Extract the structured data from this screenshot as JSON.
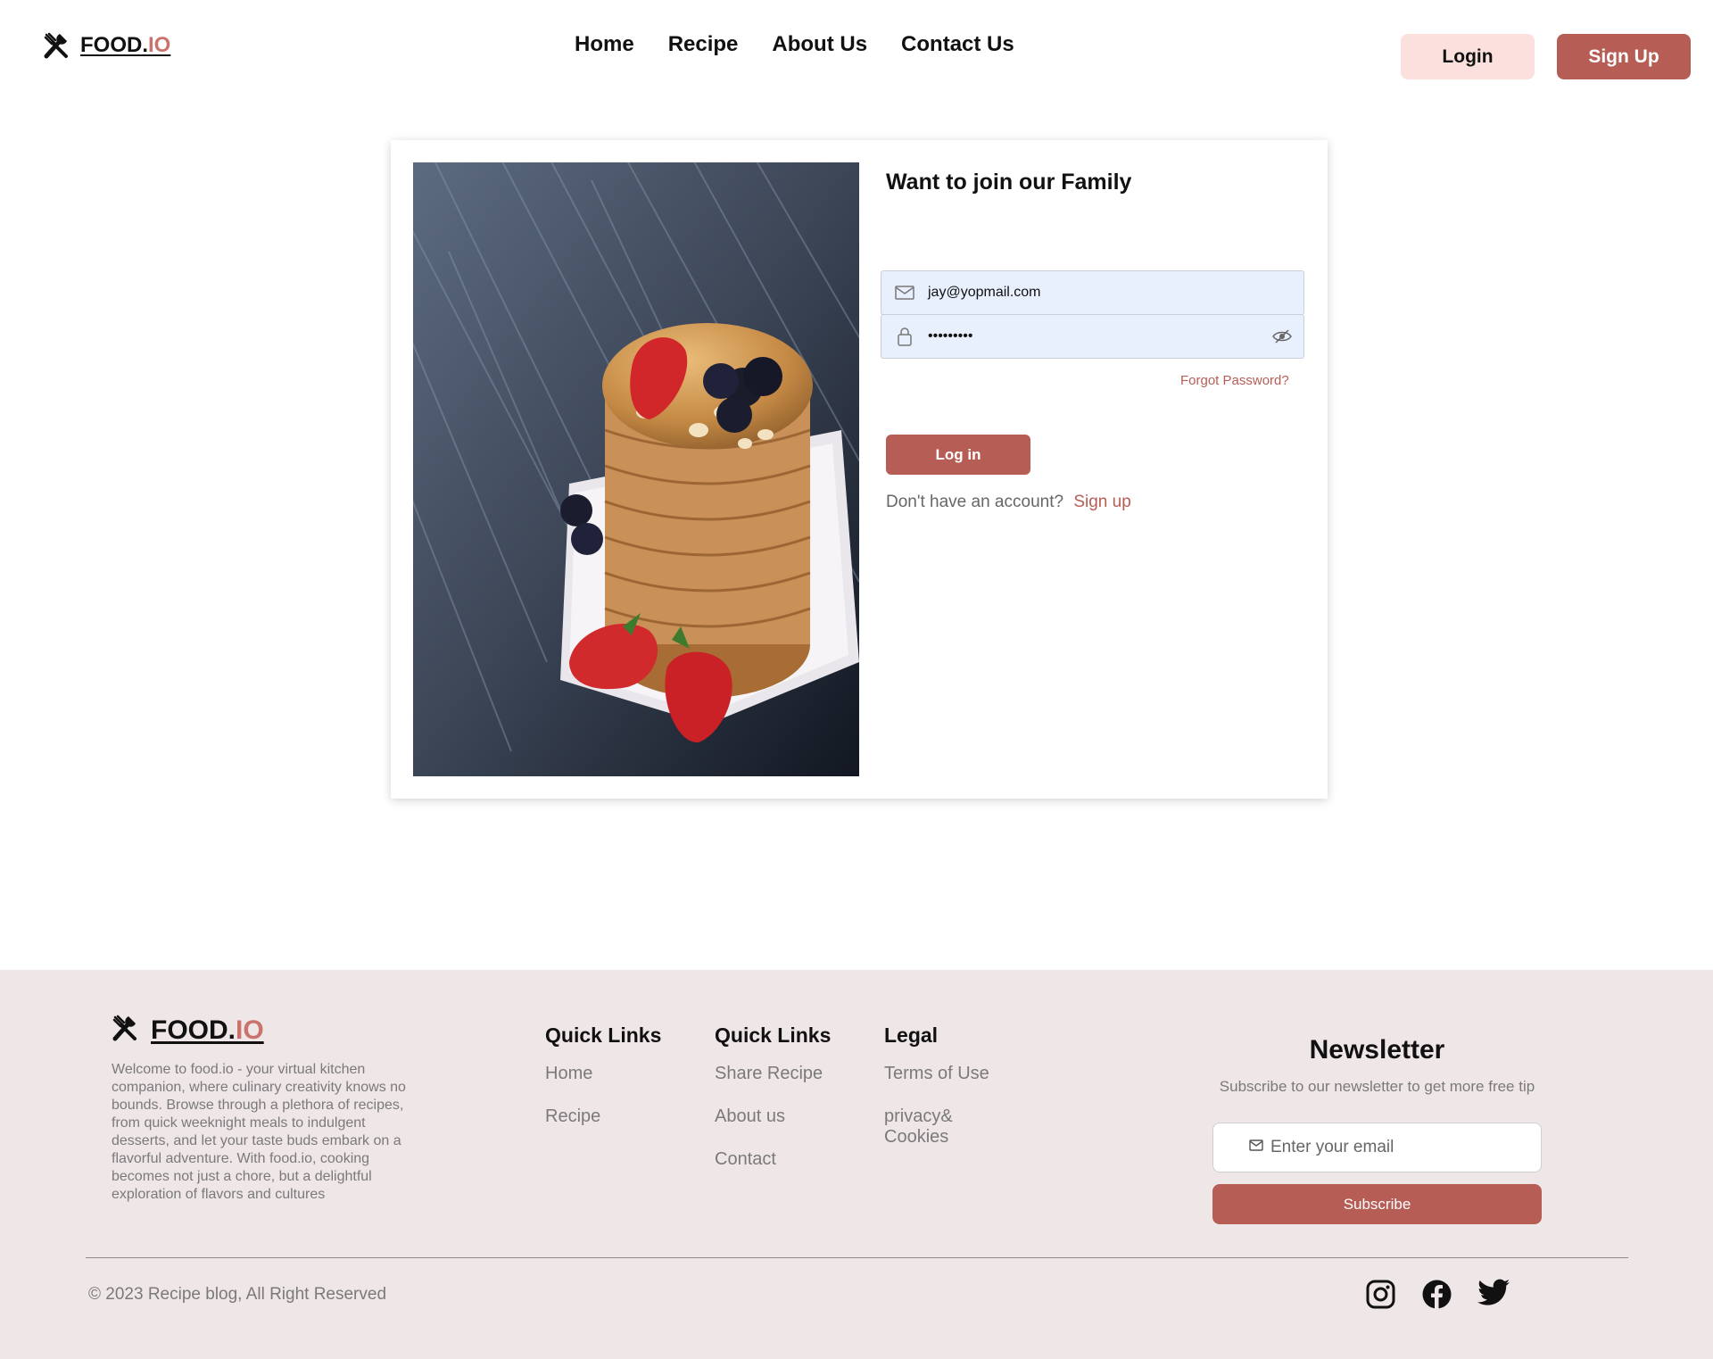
{
  "brand": {
    "name_main": "FOOD.",
    "name_accent": "IO"
  },
  "nav": {
    "items": [
      "Home",
      "Recipe",
      "About Us",
      "Contact Us"
    ]
  },
  "header_buttons": {
    "login": "Login",
    "signup": "Sign Up"
  },
  "login_card": {
    "title": "Want to join our Family",
    "email_value": "jay@yopmail.com",
    "password_masked": "•••••••••",
    "forgot_password": "Forgot Password?",
    "login_button": "Log in",
    "no_account_text": "Don't have an account?",
    "signup_link": "Sign up",
    "image_subject": "stack of pancakes with strawberries and blueberries"
  },
  "footer": {
    "about": "Welcome to food.io - your virtual kitchen companion, where culinary creativity knows no bounds. Browse through a plethora of recipes, from quick weeknight meals to indulgent desserts, and let your taste buds embark on a flavorful adventure. With food.io, cooking becomes not just a chore, but a delightful exploration of flavors and cultures",
    "columns": [
      {
        "title": "Quick Links",
        "links": [
          "Home",
          "Recipe"
        ]
      },
      {
        "title": "Quick Links",
        "links": [
          "Share Recipe",
          "About us",
          "Contact"
        ]
      },
      {
        "title": "Legal",
        "links": [
          "Terms of Use",
          "privacy& Cookies"
        ]
      }
    ],
    "newsletter": {
      "title": "Newsletter",
      "subtitle": "Subscribe to our newsletter to get more free tip",
      "placeholder": "Enter your email",
      "button": "Subscribe"
    },
    "copyright": "© 2023 Recipe blog, All Right Reserved",
    "socials": [
      "instagram-icon",
      "facebook-icon",
      "twitter-icon"
    ]
  },
  "colors": {
    "accent": "#b65d55",
    "accent_light": "#fbe0de",
    "footer_bg": "#efe7e7",
    "field_bg": "#e8f0fe"
  }
}
